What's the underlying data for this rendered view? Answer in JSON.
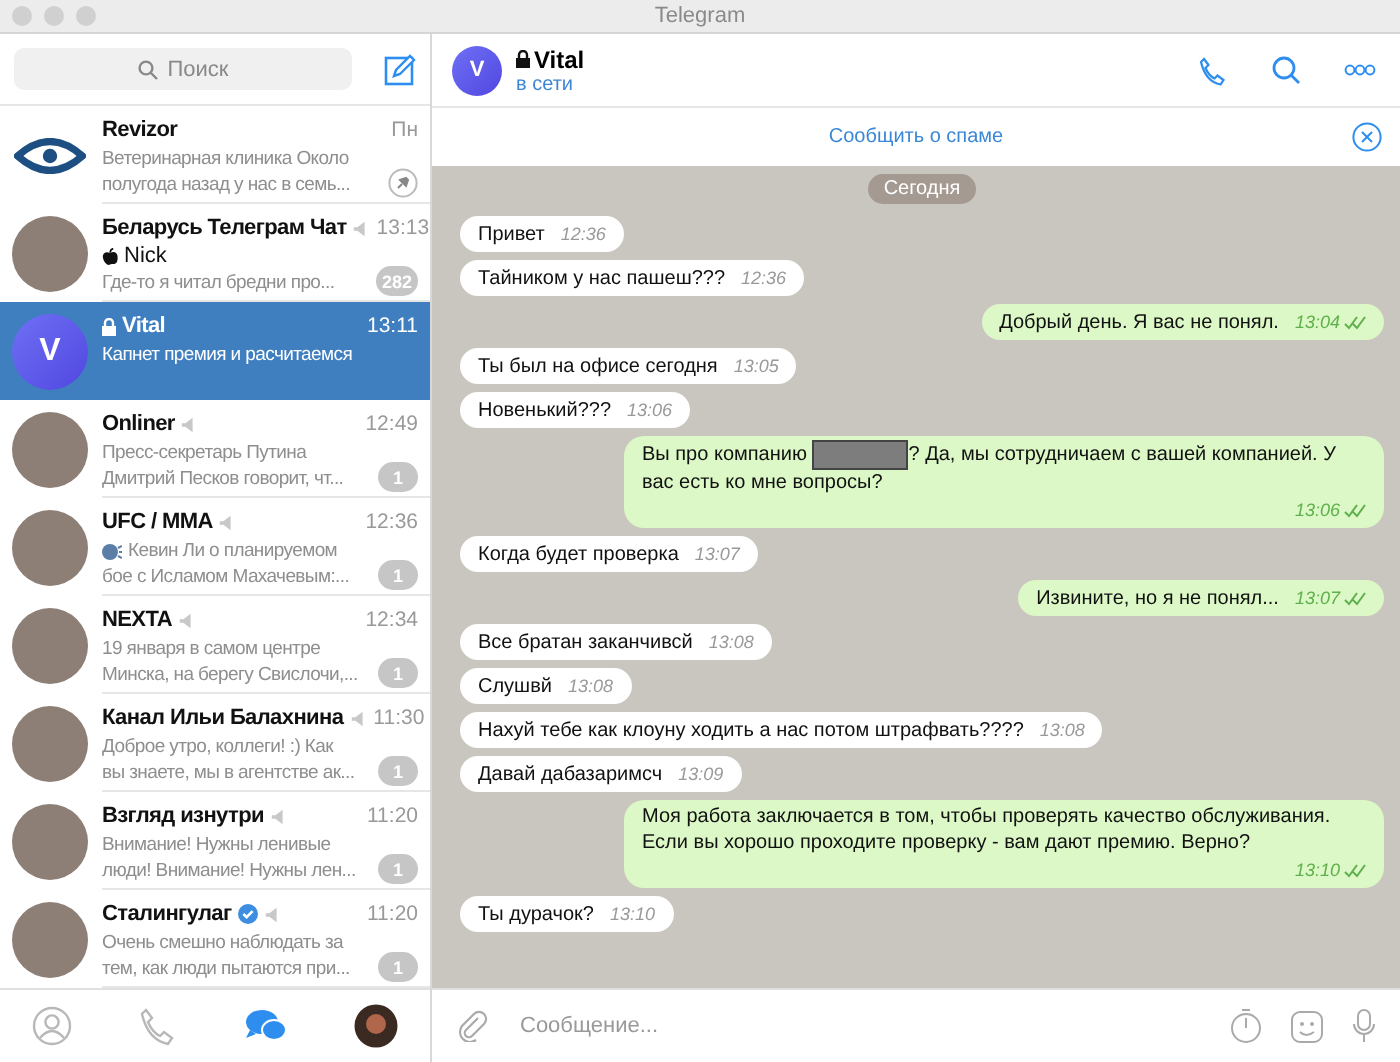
{
  "window": {
    "title": "Telegram"
  },
  "sidebar": {
    "search": {
      "placeholder": "Поиск"
    },
    "chats": [
      {
        "kind": "eye",
        "name": "Revizor",
        "time": "Пн",
        "preview": [
          "Ветеринарная клиника  Около",
          "полугода назад у нас в семь..."
        ],
        "preview_icon": false,
        "muted": false,
        "verified": false,
        "secret": false,
        "pinned": true,
        "selected": false
      },
      {
        "kind": "photo",
        "name": "Беларусь Телеграм Чат",
        "time": "13:13",
        "sender": "Nick",
        "preview": [
          "Где-то я читал бредни про..."
        ],
        "preview_icon": false,
        "muted": true,
        "verified": false,
        "secret": false,
        "pinned": false,
        "unread": "282",
        "selected": false
      },
      {
        "kind": "letter",
        "avatar_letter": "V",
        "name": "Vital",
        "time": "13:11",
        "preview": [
          "Капнет премия и расчитаемся"
        ],
        "preview_icon": false,
        "muted": false,
        "verified": false,
        "secret": true,
        "pinned": false,
        "selected": true
      },
      {
        "kind": "photo",
        "name": "Onliner",
        "time": "12:49",
        "preview": [
          "Пресс-секретарь Путина",
          "Дмитрий Песков говорит, чт..."
        ],
        "preview_icon": false,
        "muted": true,
        "verified": false,
        "secret": false,
        "pinned": false,
        "unread": "1",
        "selected": false
      },
      {
        "kind": "photo",
        "name": "UFC / MMA",
        "time": "12:36",
        "preview": [
          "Кевин Ли о планируемом",
          "бое с Исламом Махачевым:..."
        ],
        "preview_icon": true,
        "muted": true,
        "verified": false,
        "secret": false,
        "pinned": false,
        "unread": "1",
        "selected": false
      },
      {
        "kind": "photo",
        "name": "NEXTA",
        "time": "12:34",
        "preview": [
          "19 января в самом центре",
          "Минска, на берегу Свислочи,..."
        ],
        "preview_icon": false,
        "muted": true,
        "verified": false,
        "secret": false,
        "pinned": false,
        "unread": "1",
        "selected": false
      },
      {
        "kind": "photo",
        "name": "Канал Ильи Балахнина",
        "time": "11:30",
        "preview": [
          "Доброе утро, коллеги!  :)  Как",
          "вы знаете, мы в агентстве ак..."
        ],
        "preview_icon": false,
        "muted": true,
        "verified": false,
        "secret": false,
        "pinned": false,
        "unread": "1",
        "selected": false
      },
      {
        "kind": "photo",
        "name": "Взгляд изнутри",
        "time": "11:20",
        "preview": [
          "Внимание! Нужны ленивые",
          "люди! Внимание! Нужны лен..."
        ],
        "preview_icon": false,
        "muted": true,
        "verified": false,
        "secret": false,
        "pinned": false,
        "unread": "1",
        "selected": false
      },
      {
        "kind": "photo",
        "name": "Сталингулаг",
        "time": "11:20",
        "preview": [
          "Очень смешно наблюдать за",
          "тем, как люди пытаются при..."
        ],
        "preview_icon": false,
        "muted": true,
        "verified": true,
        "secret": false,
        "pinned": false,
        "unread": "1",
        "selected": false
      }
    ],
    "tabs": [
      {
        "kind": "contacts",
        "selected": false
      },
      {
        "kind": "calls",
        "selected": false
      },
      {
        "kind": "chats",
        "selected": true
      },
      {
        "kind": "settings",
        "selected": false
      }
    ]
  },
  "chat": {
    "avatar_letter": "V",
    "name": "Vital",
    "secret": true,
    "status": "в сети",
    "spam_link": "Сообщить о спаме",
    "date": "Сегодня",
    "messages": [
      {
        "out": false,
        "text": "Привет",
        "time": "12:36",
        "read": false
      },
      {
        "out": false,
        "text": "Тайником у нас пашеш???",
        "time": "12:36",
        "read": false
      },
      {
        "out": true,
        "text": "Добрый день. Я вас не понял.",
        "time": "13:04",
        "read": true
      },
      {
        "out": false,
        "text": "Ты был на офисе сегодня",
        "time": "13:05",
        "read": false
      },
      {
        "out": false,
        "text": "Новенький???",
        "time": "13:06",
        "read": false
      },
      {
        "out": true,
        "text": "Вы про компанию ",
        "text_after": "? Да, мы сотрудничаем с вашей компанией. У вас есть ко мне вопросы?",
        "time": "13:06",
        "read": true
      },
      {
        "out": false,
        "text": "Когда будет проверка",
        "time": "13:07",
        "read": false
      },
      {
        "out": true,
        "text": "Извините, но я не понял...",
        "time": "13:07",
        "read": true
      },
      {
        "out": false,
        "text": "Все братан заканчивсй",
        "time": "13:08",
        "read": false
      },
      {
        "out": false,
        "text": "Слушвй",
        "time": "13:08",
        "read": false
      },
      {
        "out": false,
        "text": "Нахуй тебе как клоуну ходить а нас потом штрафвать????",
        "time": "13:08",
        "read": false
      },
      {
        "out": false,
        "text": "Давай дабазаримсч",
        "time": "13:09",
        "read": false
      },
      {
        "out": true,
        "text": "Моя работа заключается в том, чтобы проверять качество обслуживания. Если вы хорошо проходите проверку - вам дают премию. Верно?",
        "time": "13:10",
        "read": true
      },
      {
        "out": false,
        "text": "Ты дурачок?",
        "time": "13:10",
        "read": false
      }
    ],
    "composer": {
      "placeholder": "Сообщение..."
    }
  }
}
